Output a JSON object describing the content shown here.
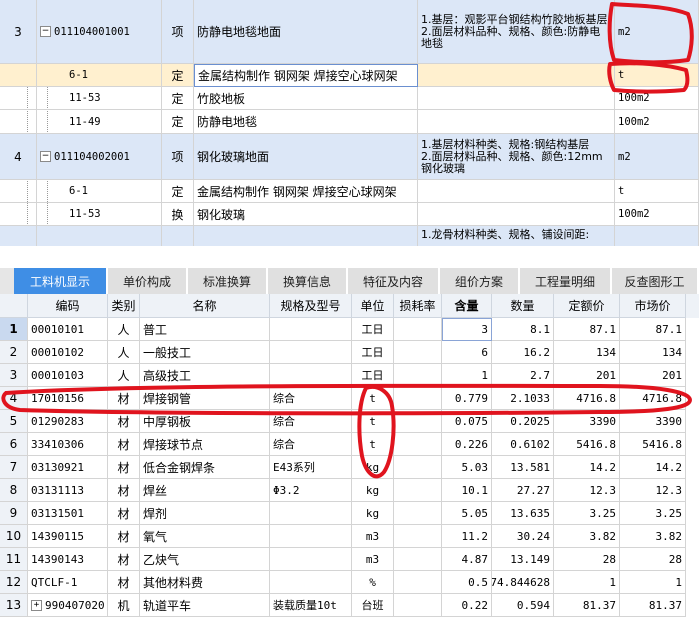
{
  "top_rows": [
    {
      "no": "3",
      "code": "011104001001",
      "type": "项",
      "name": "防静电地毯地面",
      "desc": "1.基层：观影平台钢结构竹胶地板基层\n2.面层材料品种、规格、颜色:防静电地毯",
      "unit": "m2",
      "kind": "item"
    },
    {
      "no": "",
      "code": "6-1",
      "type": "定",
      "name": "金属结构制作 钢网架 焊接空心球网架",
      "desc": "",
      "unit": "t",
      "kind": "selected"
    },
    {
      "no": "",
      "code": "11-53",
      "type": "定",
      "name": "竹胶地板",
      "desc": "",
      "unit": "100m2",
      "kind": "sub"
    },
    {
      "no": "",
      "code": "11-49",
      "type": "定",
      "name": "防静电地毯",
      "desc": "",
      "unit": "100m2",
      "kind": "sub"
    },
    {
      "no": "4",
      "code": "011104002001",
      "type": "项",
      "name": "钢化玻璃地面",
      "desc": "1.基层材料种类、规格:钢结构基层\n2.面层材料品种、规格、颜色:12mm钢化玻璃",
      "unit": "m2",
      "kind": "item"
    },
    {
      "no": "",
      "code": "6-1",
      "type": "定",
      "name": "金属结构制作 钢网架 焊接空心球网架",
      "desc": "",
      "unit": "t",
      "kind": "sub"
    },
    {
      "no": "",
      "code": "11-53",
      "type": "换",
      "name": "钢化玻璃",
      "desc": "",
      "unit": "100m2",
      "kind": "sub"
    },
    {
      "no": "",
      "code": "",
      "type": "",
      "name": "",
      "desc": "1.龙骨材料种类、规格、铺设间距:",
      "unit": "",
      "kind": "item"
    }
  ],
  "tabs": [
    {
      "label": "工料机显示",
      "active": true
    },
    {
      "label": "单价构成",
      "active": false
    },
    {
      "label": "标准换算",
      "active": false
    },
    {
      "label": "换算信息",
      "active": false
    },
    {
      "label": "特征及内容",
      "active": false
    },
    {
      "label": "组价方案",
      "active": false
    },
    {
      "label": "工程量明细",
      "active": false
    },
    {
      "label": "反查图形工",
      "active": false
    }
  ],
  "columns": [
    "编码",
    "类别",
    "名称",
    "规格及型号",
    "单位",
    "损耗率",
    "含量",
    "数量",
    "定额价",
    "市场价"
  ],
  "rows": [
    {
      "idx": "1",
      "code": "00010101",
      "cat": "人",
      "name": "普工",
      "spec": "",
      "unit": "工日",
      "loss": "",
      "qty": "3",
      "amount": "8.1",
      "quota": "87.1",
      "market": "87.1"
    },
    {
      "idx": "2",
      "code": "00010102",
      "cat": "人",
      "name": "一般技工",
      "spec": "",
      "unit": "工日",
      "loss": "",
      "qty": "6",
      "amount": "16.2",
      "quota": "134",
      "market": "134"
    },
    {
      "idx": "3",
      "code": "00010103",
      "cat": "人",
      "name": "高级技工",
      "spec": "",
      "unit": "工日",
      "loss": "",
      "qty": "1",
      "amount": "2.7",
      "quota": "201",
      "market": "201"
    },
    {
      "idx": "4",
      "code": "17010156",
      "cat": "材",
      "name": "焊接钢管",
      "spec": "综合",
      "unit": "t",
      "loss": "",
      "qty": "0.779",
      "amount": "2.1033",
      "quota": "4716.8",
      "market": "4716.8"
    },
    {
      "idx": "5",
      "code": "01290283",
      "cat": "材",
      "name": "中厚钢板",
      "spec": "综合",
      "unit": "t",
      "loss": "",
      "qty": "0.075",
      "amount": "0.2025",
      "quota": "3390",
      "market": "3390"
    },
    {
      "idx": "6",
      "code": "33410306",
      "cat": "材",
      "name": "焊接球节点",
      "spec": "综合",
      "unit": "t",
      "loss": "",
      "qty": "0.226",
      "amount": "0.6102",
      "quota": "5416.8",
      "market": "5416.8"
    },
    {
      "idx": "7",
      "code": "03130921",
      "cat": "材",
      "name": "低合金钢焊条",
      "spec": "E43系列",
      "unit": "kg",
      "loss": "",
      "qty": "5.03",
      "amount": "13.581",
      "quota": "14.2",
      "market": "14.2"
    },
    {
      "idx": "8",
      "code": "03131113",
      "cat": "材",
      "name": "焊丝",
      "spec": "Φ3.2",
      "unit": "kg",
      "loss": "",
      "qty": "10.1",
      "amount": "27.27",
      "quota": "12.3",
      "market": "12.3"
    },
    {
      "idx": "9",
      "code": "03131501",
      "cat": "材",
      "name": "焊剂",
      "spec": "",
      "unit": "kg",
      "loss": "",
      "qty": "5.05",
      "amount": "13.635",
      "quota": "3.25",
      "market": "3.25"
    },
    {
      "idx": "10",
      "code": "14390115",
      "cat": "材",
      "name": "氧气",
      "spec": "",
      "unit": "m3",
      "loss": "",
      "qty": "11.2",
      "amount": "30.24",
      "quota": "3.82",
      "market": "3.82"
    },
    {
      "idx": "11",
      "code": "14390143",
      "cat": "材",
      "name": "乙炔气",
      "spec": "",
      "unit": "m3",
      "loss": "",
      "qty": "4.87",
      "amount": "13.149",
      "quota": "28",
      "market": "28"
    },
    {
      "idx": "12",
      "code": "QTCLF-1",
      "cat": "材",
      "name": "其他材料费",
      "spec": "",
      "unit": "%",
      "loss": "",
      "qty": "0.5",
      "amount": "74.844628",
      "quota": "1",
      "market": "1"
    },
    {
      "idx": "13",
      "code": "990407020",
      "cat": "机",
      "name": "轨道平车",
      "spec": "装载质量10t",
      "unit": "台班",
      "loss": "",
      "qty": "0.22",
      "amount": "0.594",
      "quota": "81.37",
      "market": "81.37"
    }
  ],
  "colors": {
    "accent": "#3f8ee5",
    "annotation": "#e0141e",
    "row_blue": "#dce7f7",
    "row_selected": "#fff0cf"
  }
}
